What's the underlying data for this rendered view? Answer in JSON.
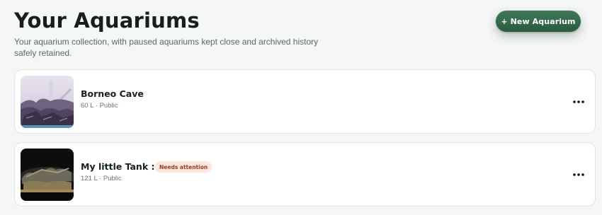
{
  "header": {
    "title": "Your Aquariums",
    "subtitle": "Your aquarium collection, with paused aquariums kept close and archived history safely retained.",
    "new_button_label": "+ New Aquarium"
  },
  "aquariums": [
    {
      "name": "Borneo Cave",
      "meta": "60 L · Public",
      "badge": ""
    },
    {
      "name": "My little Tank :-)",
      "meta": "121 L · Public",
      "badge": "Needs attention"
    }
  ],
  "icons": {
    "more": "more-horizontal-icon"
  },
  "colors": {
    "accent": "#2f6b48",
    "badge_bg": "#fde6de",
    "badge_text": "#9a3a1e"
  }
}
